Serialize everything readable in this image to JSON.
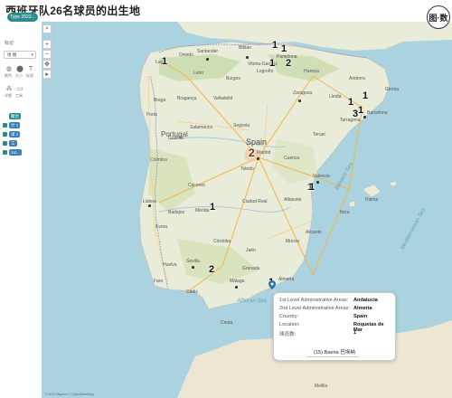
{
  "header": {
    "title": "西班牙队26名球员的出生地",
    "brand_badge": "图·数"
  },
  "left_panel": {
    "type_pill": "Type 2023...",
    "marks_label": "标记",
    "mark_select": "地 图",
    "icon_labels": [
      "颜色",
      "大小",
      "标签",
      "详细",
      "工具"
    ],
    "chips": [
      "聚合",
      "计 1",
      "详 1",
      "工",
      "1st..."
    ],
    "colors": {
      "teal": "#2c8b8f",
      "chip_blue": "#3a7fb8"
    }
  },
  "map": {
    "country_label": "Spain",
    "neighbor_label": "Portugal",
    "sea_labels": [
      "Balearic Sea",
      "Mediterranean Sea",
      "Alboran Sea"
    ],
    "cities": [
      {
        "name": "Santander"
      },
      {
        "name": "Bilbao"
      },
      {
        "name": "Oviedo"
      },
      {
        "name": "Lugo"
      },
      {
        "name": "Vitoria-Gasteiz"
      },
      {
        "name": "Burgos"
      },
      {
        "name": "Pamplona"
      },
      {
        "name": "León"
      },
      {
        "name": "Logroño"
      },
      {
        "name": "Zaragoza"
      },
      {
        "name": "Huesca"
      },
      {
        "name": "Valladolid"
      },
      {
        "name": "Salamanca"
      },
      {
        "name": "Segovia"
      },
      {
        "name": "Madrid"
      },
      {
        "name": "Toledo"
      },
      {
        "name": "Cuenca"
      },
      {
        "name": "Teruel"
      },
      {
        "name": "Cáceres"
      },
      {
        "name": "Mérida"
      },
      {
        "name": "Badajoz"
      },
      {
        "name": "Ciudad Real"
      },
      {
        "name": "Albacete"
      },
      {
        "name": "Valencia"
      },
      {
        "name": "Alicante"
      },
      {
        "name": "Murcia"
      },
      {
        "name": "Córdoba"
      },
      {
        "name": "Sevilla"
      },
      {
        "name": "Granada"
      },
      {
        "name": "Almería"
      },
      {
        "name": "Málaga"
      },
      {
        "name": "Cádiz"
      },
      {
        "name": "Huelva"
      },
      {
        "name": "Jaén"
      },
      {
        "name": "Barcelona"
      },
      {
        "name": "Tarragona"
      },
      {
        "name": "Lleida"
      },
      {
        "name": "Girona"
      },
      {
        "name": "Porto"
      },
      {
        "name": "Braga"
      },
      {
        "name": "Coimbra"
      },
      {
        "name": "Lisboa"
      },
      {
        "name": "Faro"
      },
      {
        "name": "Évora"
      },
      {
        "name": "Guarda"
      },
      {
        "name": "Bragança"
      },
      {
        "name": "Andorra"
      },
      {
        "name": "Palma"
      },
      {
        "name": "Ibiza"
      },
      {
        "name": "Ceuta"
      },
      {
        "name": "Melilla"
      }
    ],
    "counts": [
      "1",
      "1",
      "1",
      "2",
      "1",
      "2",
      "1",
      "1",
      "3",
      "1",
      "1",
      "1",
      "2",
      "1",
      "1"
    ],
    "attribution": "© 2023 Mapbox © OpenStreetMap",
    "colors": {
      "sea": "#aad3df",
      "land": "#e8ecd8",
      "forest": "#c9dcae",
      "road": "#f2b44a"
    }
  },
  "tooltip": {
    "rows": [
      {
        "key": "1st Level Administrative Areas:",
        "value": "Andalucia"
      },
      {
        "key": "2nd Level Administrative Areas:",
        "value": "Almeria"
      },
      {
        "key": "Country:",
        "value": "Spain"
      },
      {
        "key": "Location:",
        "value": "Roquetas de Mar"
      },
      {
        "key": "球员数:",
        "value": "1"
      }
    ],
    "footer": "(15) Baena   巴埃纳"
  }
}
